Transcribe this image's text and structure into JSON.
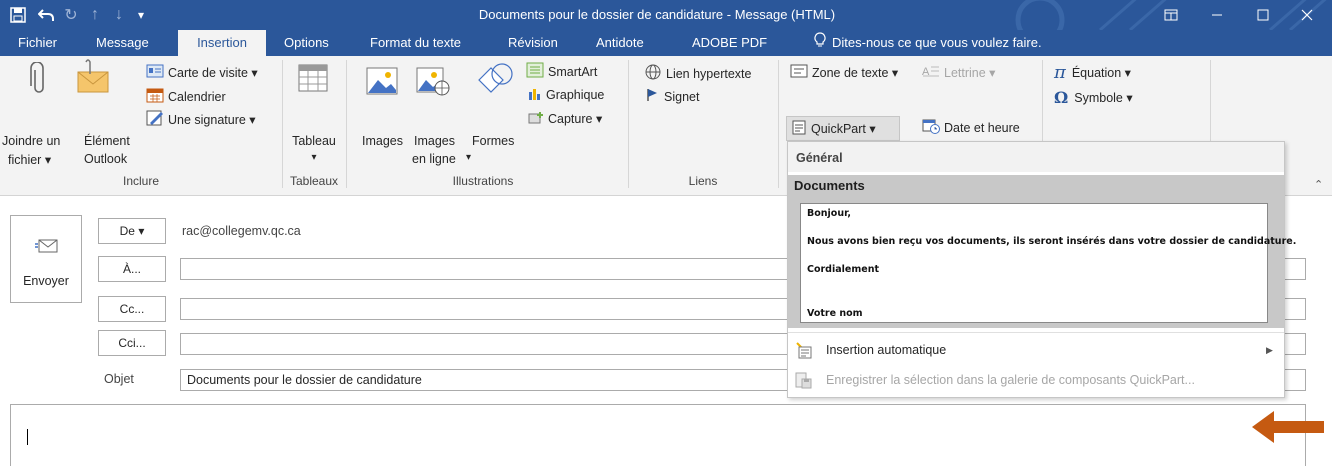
{
  "window": {
    "title": "Documents pour le dossier de candidature - Message (HTML)"
  },
  "tabs": [
    {
      "label": "Fichier"
    },
    {
      "label": "Message"
    },
    {
      "label": "Insertion"
    },
    {
      "label": "Options"
    },
    {
      "label": "Format du texte"
    },
    {
      "label": "Révision"
    },
    {
      "label": "Antidote"
    },
    {
      "label": "ADOBE PDF"
    },
    {
      "label": "Dites-nous ce que vous voulez faire."
    }
  ],
  "ribbon": {
    "inclure": {
      "label": "Inclure",
      "joindre_1": "Joindre un",
      "joindre_2": "fichier ▾",
      "element_1": "Élément",
      "element_2": "Outlook",
      "carte": "Carte de visite ▾",
      "calendrier": "Calendrier",
      "signature": "Une signature ▾"
    },
    "tableaux": {
      "label": "Tableaux",
      "tableau": "Tableau",
      "caret": "▾"
    },
    "illustrations": {
      "label": "Illustrations",
      "images": "Images",
      "images_ligne_1": "Images",
      "images_ligne_2": "en ligne",
      "formes": "Formes",
      "smartart": "SmartArt",
      "graphique": "Graphique",
      "capture": "Capture ▾",
      "caret": "▾"
    },
    "liens": {
      "label": "Liens",
      "lien": "Lien hypertexte",
      "signet": "Signet"
    },
    "texte": {
      "zone": "Zone de texte ▾",
      "lettrine": "Lettrine ▾",
      "quickpart": "QuickPart ▾",
      "date": "Date et heure"
    },
    "symboles": {
      "equation": "Équation  ▾",
      "symbole": "Symbole ▾"
    }
  },
  "compose": {
    "send": "Envoyer",
    "from_btn": "De ▾",
    "from_value": "rac@collegemv.qc.ca",
    "to_btn": "À...",
    "cc_btn": "Cc...",
    "bcc_btn": "Cci...",
    "subject_label": "Objet",
    "subject_value": "Documents pour le dossier de candidature"
  },
  "quickpart_menu": {
    "general": "Général",
    "documents": "Documents",
    "preview": {
      "line1": "Bonjour,",
      "line2": "Nous avons bien reçu vos documents, ils seront insérés dans votre dossier de candidature.",
      "line3": "Cordialement",
      "line4": "Votre nom"
    },
    "autotext": "Insertion automatique",
    "save": "Enregistrer la sélection dans la galerie de composants QuickPart..."
  },
  "colors": {
    "title_bar": "#2b579a",
    "ribbon": "#f3f3f3",
    "arrow": "#c55a11"
  },
  "icons": [
    "save-icon",
    "undo-icon",
    "redo-icon",
    "up-arrow-icon",
    "down-arrow-icon",
    "customize-qat-icon",
    "ribbon-display-icon",
    "minimize-icon",
    "maximize-icon",
    "close-icon",
    "lightbulb-icon",
    "paperclip-icon",
    "outlook-item-icon",
    "business-card-icon",
    "calendar-icon",
    "signature-icon",
    "table-icon",
    "pictures-icon",
    "online-pictures-icon",
    "shapes-icon",
    "smartart-icon",
    "chart-icon",
    "screenshot-icon",
    "hyperlink-icon",
    "bookmark-icon",
    "text-box-icon",
    "drop-cap-icon",
    "quickpart-icon",
    "date-time-icon",
    "pi-icon",
    "omega-icon",
    "collapse-ribbon-icon",
    "send-icon",
    "autotext-icon",
    "save-gallery-icon",
    "submenu-arrow-icon",
    "orange-arrow-icon"
  ]
}
